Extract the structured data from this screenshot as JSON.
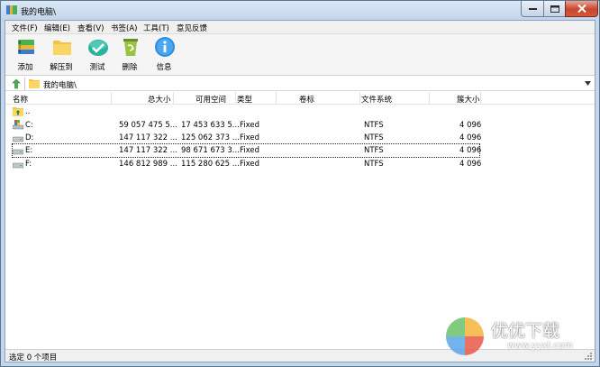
{
  "window": {
    "title": "我的电脑\\"
  },
  "menu": [
    "文件(F)",
    "编辑(E)",
    "查看(V)",
    "书签(A)",
    "工具(T)",
    "意见反馈"
  ],
  "toolbar": [
    {
      "label": "添加",
      "icon": "add-books-icon"
    },
    {
      "label": "解压到",
      "icon": "folder-icon"
    },
    {
      "label": "测试",
      "icon": "check-icon"
    },
    {
      "label": "删除",
      "icon": "recycle-bin-icon"
    },
    {
      "label": "信息",
      "icon": "info-icon"
    }
  ],
  "address": {
    "path": "我的电脑\\"
  },
  "columns": [
    "名称",
    "总大小",
    "可用空间",
    "类型",
    "卷标",
    "文件系统",
    "簇大小"
  ],
  "rows": [
    {
      "name": "..",
      "total": "",
      "free": "",
      "type": "",
      "label": "",
      "fs": "",
      "cluster": "",
      "icon": "parent-folder-icon"
    },
    {
      "name": "C:",
      "total": "59 057 475 5...",
      "free": "17 453 633 5...",
      "type": "Fixed",
      "label": "",
      "fs": "NTFS",
      "cluster": "4 096",
      "icon": "system-drive-icon"
    },
    {
      "name": "D:",
      "total": "147 117 322 ...",
      "free": "125 062 373 ...",
      "type": "Fixed",
      "label": "",
      "fs": "NTFS",
      "cluster": "4 096",
      "icon": "drive-icon"
    },
    {
      "name": "E:",
      "total": "147 117 322 ...",
      "free": "98 671 673 3...",
      "type": "Fixed",
      "label": "",
      "fs": "NTFS",
      "cluster": "4 096",
      "icon": "drive-icon"
    },
    {
      "name": "F:",
      "total": "146 812 989 ...",
      "free": "115 280 625 ...",
      "type": "Fixed",
      "label": "",
      "fs": "NTFS",
      "cluster": "4 096",
      "icon": "drive-icon"
    }
  ],
  "status": {
    "text": "选定 0 个项目"
  },
  "watermark": {
    "title": "优优下载",
    "url": "www.yyxt.com"
  },
  "colors": {
    "titlebar": "#c4d6e9",
    "close_button": "#c8462b",
    "toolbar_bg": "#f5f5f5"
  }
}
